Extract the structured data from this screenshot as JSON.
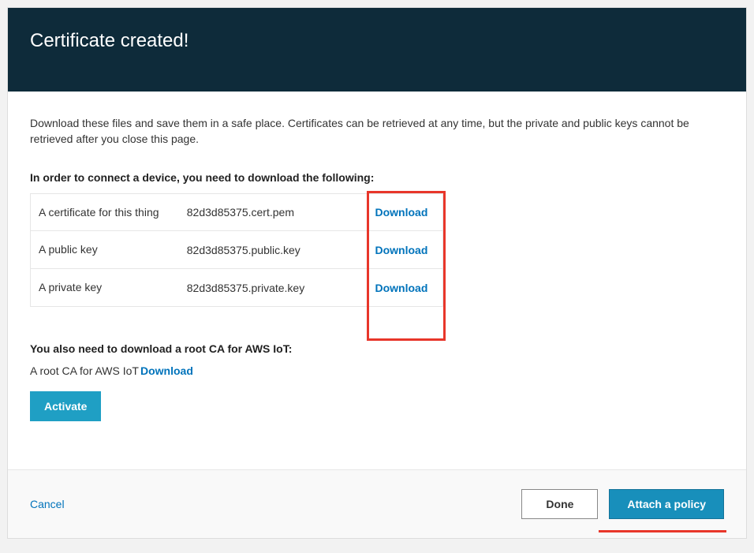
{
  "header": {
    "title": "Certificate created!"
  },
  "intro": "Download these files and save them in a safe place. Certificates can be retrieved at any time, but the private and public keys cannot be retrieved after you close this page.",
  "section1_title": "In order to connect a device, you need to download the following:",
  "files": [
    {
      "desc": "A certificate for this thing",
      "name": "82d3d85375.cert.pem",
      "action": "Download"
    },
    {
      "desc": "A public key",
      "name": "82d3d85375.public.key",
      "action": "Download"
    },
    {
      "desc": "A private key",
      "name": "82d3d85375.private.key",
      "action": "Download"
    }
  ],
  "rootca": {
    "title": "You also need to download a root CA for AWS IoT:",
    "label": "A root CA for AWS IoT",
    "download": "Download"
  },
  "buttons": {
    "activate": "Activate",
    "cancel": "Cancel",
    "done": "Done",
    "attach": "Attach a policy"
  }
}
